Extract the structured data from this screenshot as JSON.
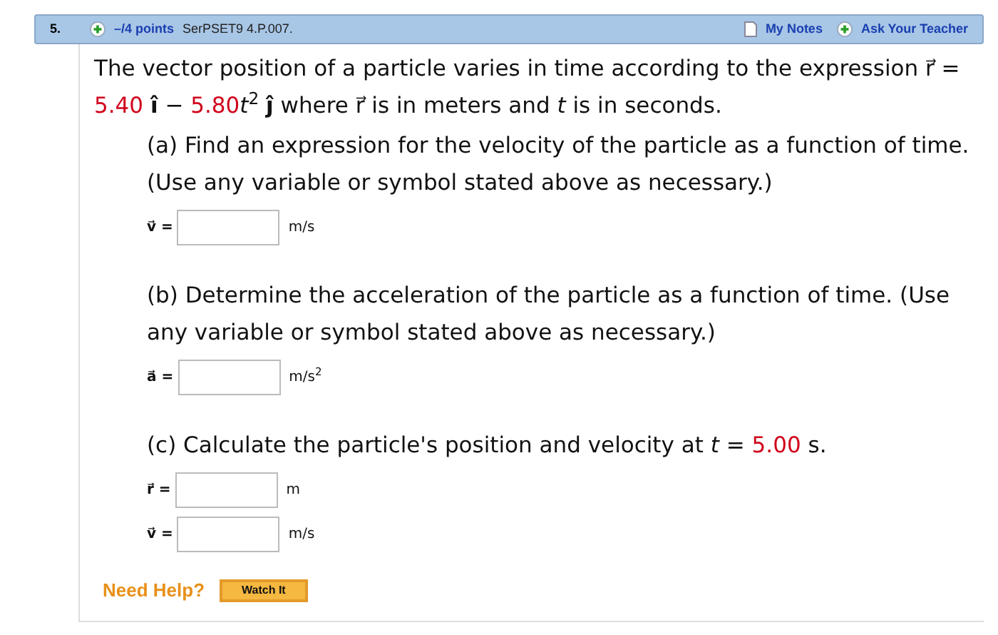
{
  "header": {
    "number": "5.",
    "points": "–/4 points",
    "code": "SerPSET9 4.P.007.",
    "my_notes": "My Notes",
    "ask_teacher": "Ask Your Teacher"
  },
  "statement": [
    {
      "kind": "text",
      "text": "The vector position of a particle varies in time according to the expression r⃗ = "
    },
    {
      "kind": "value",
      "text": "5.40"
    },
    {
      "kind": "text",
      "text": " **î** − "
    },
    {
      "kind": "value",
      "text": "5.80"
    },
    {
      "kind": "text",
      "text": "*t*$^{2}$ **ĵ** where r⃗ is in meters and *t* is in seconds."
    }
  ],
  "parts": [
    {
      "question": [
        {
          "kind": "text",
          "text": "(a) Find an expression for the velocity of the particle as a function of time. (Use any variable or symbol stated above as necessary.)"
        }
      ],
      "answers": [
        {
          "label": "v⃗ =",
          "unit": "m/s"
        }
      ]
    },
    {
      "question": [
        {
          "kind": "text",
          "text": "(b) Determine the acceleration of the particle as a function of time. (Use any variable or symbol stated above as necessary.)"
        }
      ],
      "answers": [
        {
          "label": "a⃗ =",
          "unit": "m/s$^{2}$"
        }
      ]
    },
    {
      "question": [
        {
          "kind": "text",
          "text": "(c) Calculate the particle's position and velocity at *t* = "
        },
        {
          "kind": "value",
          "text": "5.00"
        },
        {
          "kind": "text",
          "text": " s."
        }
      ],
      "answers": [
        {
          "label": "r⃗ =",
          "unit": "m"
        },
        {
          "label": "v⃗ =",
          "unit": "m/s"
        }
      ]
    }
  ],
  "help": {
    "label": "Need Help?",
    "button": "Watch It"
  }
}
